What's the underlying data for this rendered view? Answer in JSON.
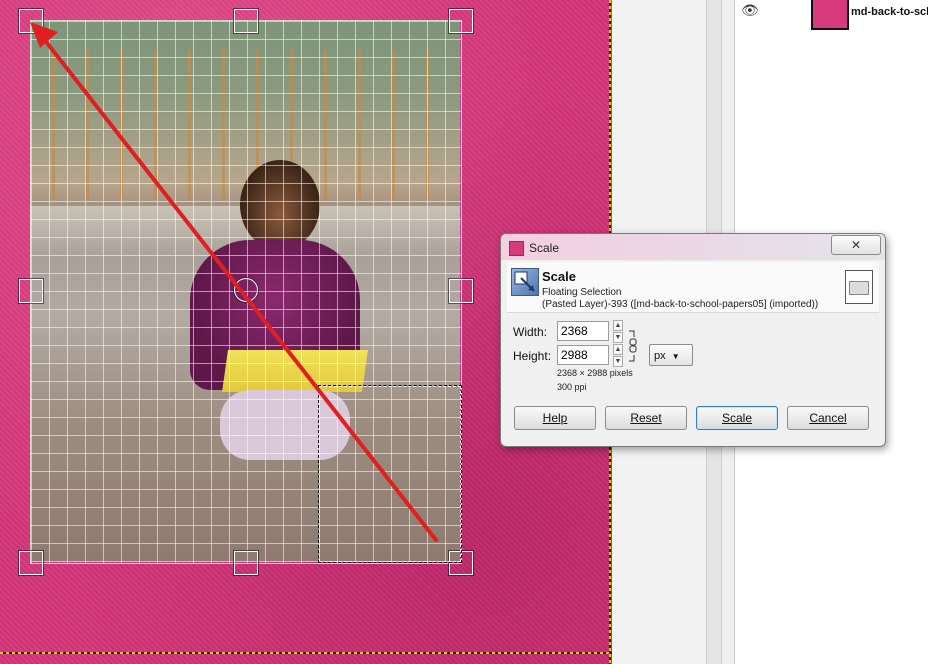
{
  "dialog": {
    "window_title": "Scale",
    "close_label": "✕",
    "heading": "Scale",
    "subtitle": "Floating Selection",
    "layer_info": "(Pasted Layer)-393 ([md-back-to-school-papers05] (imported))",
    "width_label": "Width:",
    "width_value": "2368",
    "height_label": "Height:",
    "height_value": "2988",
    "unit": "px",
    "dimensions_text": "2368 × 2988 pixels",
    "resolution_text": "300 ppi",
    "buttons": {
      "help": "Help",
      "reset": "Reset",
      "scale": "Scale",
      "cancel": "Cancel"
    }
  },
  "layers": {
    "name": "md-back-to-scho"
  },
  "icons": {
    "eye": "eye-icon",
    "chain": "chain-link-icon",
    "dropdown": "chevron-down-icon"
  },
  "colors": {
    "canvas_pink": "#d4357a",
    "arrow_red": "#e02020",
    "button_focus": "#3c7fb1"
  }
}
